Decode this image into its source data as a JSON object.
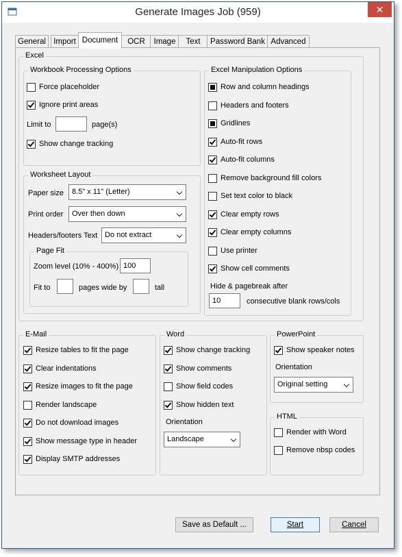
{
  "window": {
    "title": "Generate Images Job (959)",
    "close_glyph": "✕"
  },
  "tabs": [
    "General",
    "Import",
    "Document",
    "OCR",
    "Image",
    "Text",
    "Password Bank",
    "Advanced"
  ],
  "active_tab": "Document",
  "excel": {
    "label": "Excel",
    "workbook": {
      "label": "Workbook Processing Options",
      "force_placeholder": {
        "label": "Force placeholder",
        "checked": false
      },
      "ignore_print_areas": {
        "label": "Ignore print areas",
        "checked": true
      },
      "limit_to_label": "Limit to",
      "limit_to_value": "",
      "pages_suffix": "page(s)",
      "show_change_tracking": {
        "label": "Show change tracking",
        "checked": true
      }
    },
    "worksheet": {
      "label": "Worksheet Layout",
      "paper_size_label": "Paper size",
      "paper_size_value": "8.5\" x 11\" (Letter)",
      "print_order_label": "Print order",
      "print_order_value": "Over then down",
      "headers_footers_label": "Headers/footers Text",
      "headers_footers_value": "Do not extract",
      "page_fit": {
        "label": "Page Fit",
        "zoom_label": "Zoom level (10% - 400%)",
        "zoom_value": "100",
        "fit_to_label": "Fit to",
        "pages_wide_label": "pages wide by",
        "tall_label": "tall",
        "wide_value": "",
        "tall_value": ""
      }
    },
    "manipulation": {
      "label": "Excel Manipulation Options",
      "options": [
        {
          "label": "Row and column headings",
          "state": "filled"
        },
        {
          "label": "Headers and footers",
          "state": "unchecked"
        },
        {
          "label": "Gridlines",
          "state": "filled"
        },
        {
          "label": "Auto-fit rows",
          "state": "checked"
        },
        {
          "label": "Auto-fit columns",
          "state": "checked"
        },
        {
          "label": "Remove background fill colors",
          "state": "unchecked"
        },
        {
          "label": "Set text color to black",
          "state": "unchecked"
        },
        {
          "label": "Clear empty rows",
          "state": "checked"
        },
        {
          "label": "Clear empty columns",
          "state": "checked"
        },
        {
          "label": "Use printer",
          "state": "unchecked"
        },
        {
          "label": "Show cell comments",
          "state": "checked"
        }
      ],
      "hide_label": "Hide & pagebreak after",
      "hide_value": "10",
      "blank_label": "consecutive blank rows/cols"
    }
  },
  "email": {
    "label": "E-Mail",
    "options": [
      {
        "label": "Resize tables to fit the page",
        "checked": true
      },
      {
        "label": "Clear indentations",
        "checked": true
      },
      {
        "label": "Resize images to fit the page",
        "checked": true
      },
      {
        "label": "Render landscape",
        "checked": false
      },
      {
        "label": "Do not download images",
        "checked": true
      },
      {
        "label": "Show message type in header",
        "checked": true
      },
      {
        "label": "Display SMTP addresses",
        "checked": true
      }
    ]
  },
  "word": {
    "label": "Word",
    "options": [
      {
        "label": "Show change tracking",
        "checked": true
      },
      {
        "label": "Show comments",
        "checked": true
      },
      {
        "label": "Show field codes",
        "checked": false
      },
      {
        "label": "Show hidden text",
        "checked": true
      }
    ],
    "orientation_label": "Orientation",
    "orientation_value": "Landscape"
  },
  "powerpoint": {
    "label": "PowerPoint",
    "speaker_notes": {
      "label": "Show speaker notes",
      "checked": true
    },
    "orientation_label": "Orientation",
    "orientation_value": "Original setting"
  },
  "html": {
    "label": "HTML",
    "options": [
      {
        "label": "Render with Word",
        "checked": false
      },
      {
        "label": "Remove nbsp codes",
        "checked": false
      }
    ]
  },
  "buttons": {
    "save_default": "Save as Default ...",
    "start": "Start",
    "cancel": "Cancel"
  }
}
